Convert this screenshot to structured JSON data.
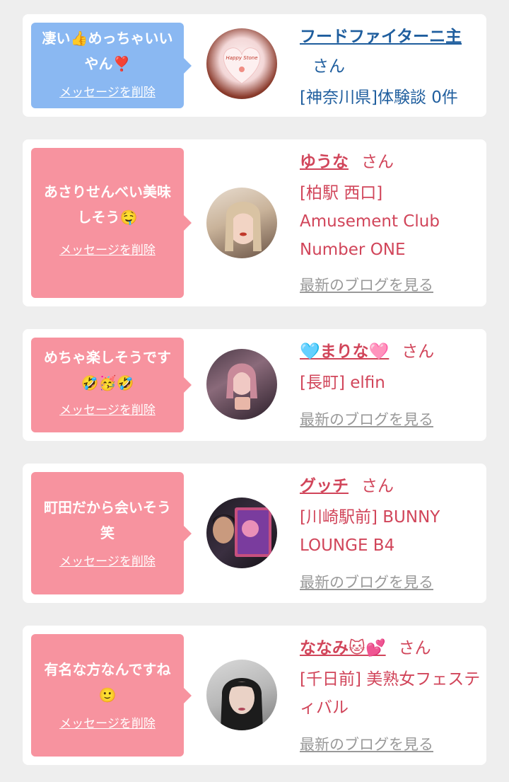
{
  "delete_label": "メッセージを削除",
  "honorific": "さん",
  "blog_label": "最新のブログを見る",
  "cards": [
    {
      "message": "凄い👍めっちゃいいやん❣️",
      "name": "フードファイターニ主",
      "shop": "[神奈川県]体験談 0件",
      "avatar_text": "Happy Stone",
      "theme": "blue"
    },
    {
      "message": "あさりせんべい美味しそう🤤",
      "name": "ゆうな",
      "shop": "[柏駅 西口] Amusement Club Number ONE",
      "theme": "pink"
    },
    {
      "message": "めちゃ楽しそうです🤣🥳🤣",
      "name": "🩵まりな🩷",
      "shop": "[長町] elfin",
      "theme": "pink"
    },
    {
      "message": "町田だから会いそう笑",
      "name": "グッチ",
      "shop": "[川崎駅前] BUNNY LOUNGE B4",
      "theme": "pink"
    },
    {
      "message": "有名な方なんですね🙂",
      "name": "ななみ🐱💕",
      "shop": "[千日前] 美熟女フェスティバル",
      "theme": "pink"
    }
  ],
  "colors": {
    "background": "#eeeeee",
    "bubble_blue": "#8ab8f2",
    "bubble_pink": "#f7939f",
    "name_blue": "#1f5e9e",
    "name_pink": "#d1455a",
    "blog_gray": "#999999"
  }
}
